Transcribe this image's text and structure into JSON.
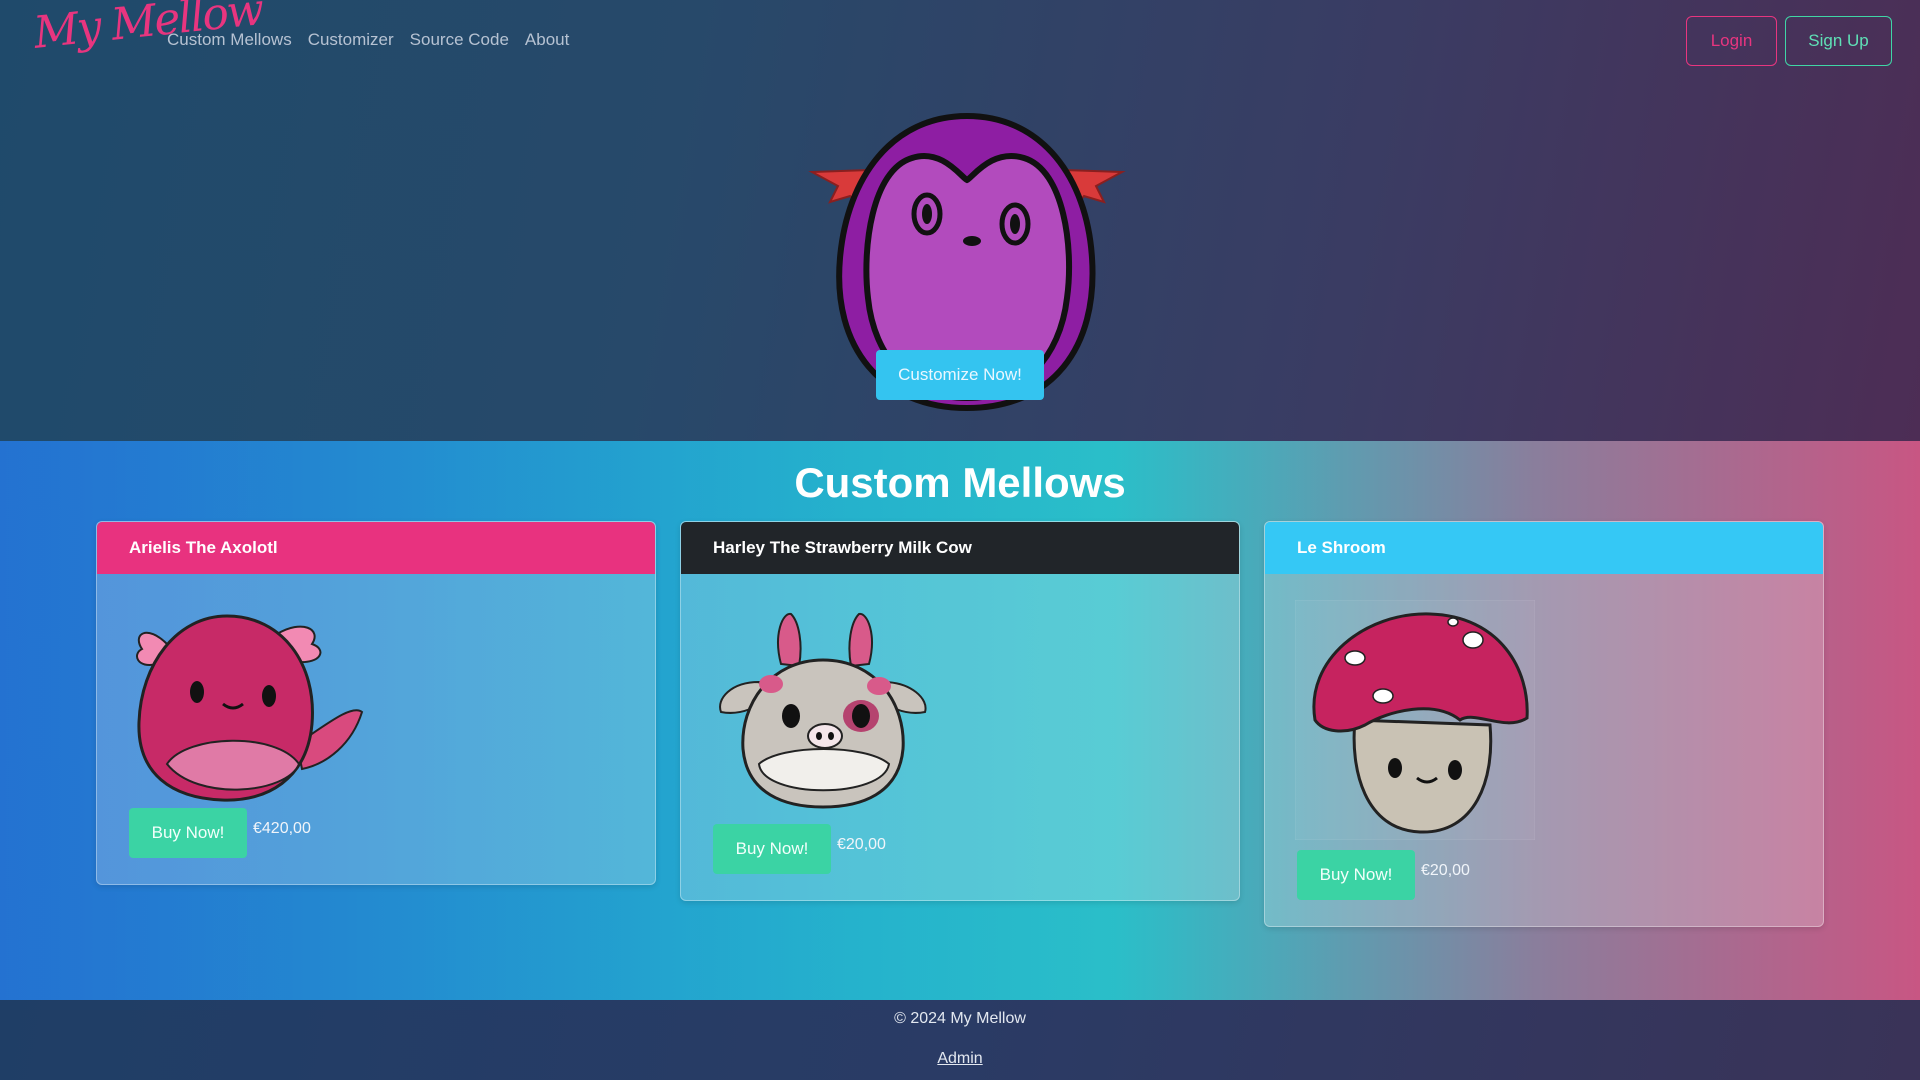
{
  "brand": "My Mellow",
  "nav": {
    "items": [
      {
        "label": "Custom Mellows"
      },
      {
        "label": "Customizer"
      },
      {
        "label": "Source Code"
      },
      {
        "label": "About"
      }
    ],
    "login_label": "Login",
    "signup_label": "Sign Up"
  },
  "hero": {
    "cta_label": "Customize Now!"
  },
  "section": {
    "title": "Custom Mellows"
  },
  "products": [
    {
      "name": "Arielis The Axolotl",
      "buy_label": "Buy Now!",
      "price": "€420,00",
      "header_color": "#e8327f"
    },
    {
      "name": "Harley The Strawberry Milk Cow",
      "buy_label": "Buy Now!",
      "price": "€20,00",
      "header_color": "#212529"
    },
    {
      "name": "Le Shroom",
      "buy_label": "Buy Now!",
      "price": "€20,00",
      "header_color": "#35c8f5"
    }
  ],
  "footer": {
    "copyright": "© 2024 My Mellow",
    "admin_label": "Admin"
  },
  "colors": {
    "primary_pink": "#e8357f",
    "accent_green": "#3bd3a4",
    "accent_cyan": "#34c4f0"
  }
}
